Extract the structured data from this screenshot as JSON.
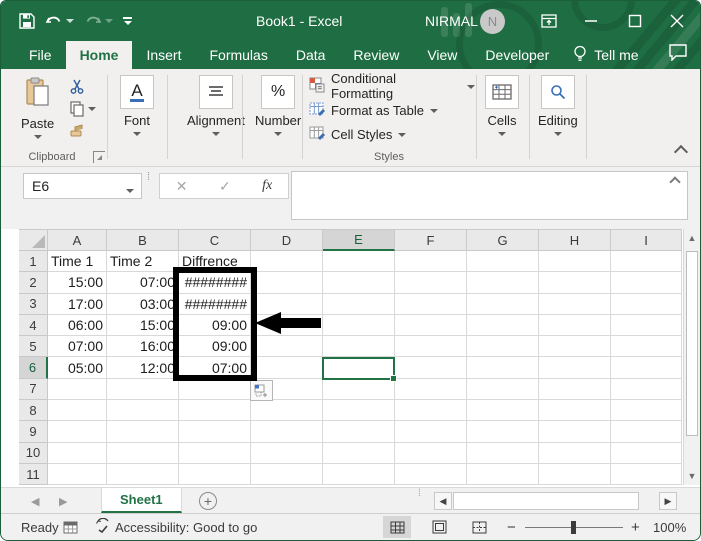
{
  "window": {
    "title": "Book1 - Excel",
    "user": "NIRMAL",
    "avatar_initial": "N"
  },
  "tabs": {
    "items": [
      {
        "label": "File"
      },
      {
        "label": "Home"
      },
      {
        "label": "Insert"
      },
      {
        "label": "Formulas"
      },
      {
        "label": "Data"
      },
      {
        "label": "Review"
      },
      {
        "label": "View"
      },
      {
        "label": "Developer"
      }
    ],
    "tell_me": "Tell me"
  },
  "ribbon": {
    "paste_label": "Paste",
    "clipboard_label": "Clipboard",
    "font_label": "Font",
    "alignment_label": "Alignment",
    "number_label": "Number",
    "number_icon_glyph": "%",
    "font_icon_glyph": "A",
    "styles_items": [
      {
        "label": "Conditional Formatting"
      },
      {
        "label": "Format as Table"
      },
      {
        "label": "Cell Styles"
      }
    ],
    "styles_label": "Styles",
    "cells_label": "Cells",
    "editing_label": "Editing"
  },
  "formula_bar": {
    "name_box": "E6",
    "cancel_glyph": "✕",
    "enter_glyph": "✓",
    "fx_label": "fx",
    "value": ""
  },
  "grid": {
    "columns": [
      "A",
      "B",
      "C",
      "D",
      "E",
      "F",
      "G",
      "H",
      "I"
    ],
    "rows": [
      "1",
      "2",
      "3",
      "4",
      "5",
      "6",
      "7",
      "8",
      "9",
      "10",
      "11"
    ],
    "cells": [
      [
        "Time 1",
        "Time 2",
        "Diffrence"
      ],
      [
        "15:00",
        "07:00",
        "########"
      ],
      [
        "17:00",
        "03:00",
        "########"
      ],
      [
        "06:00",
        "15:00",
        "09:00"
      ],
      [
        "07:00",
        "16:00",
        "09:00"
      ],
      [
        "05:00",
        "12:00",
        "07:00"
      ],
      [],
      [],
      [],
      [],
      []
    ],
    "selected_cell": "E6",
    "selected_column": "E",
    "selected_row": "6"
  },
  "sheet_tabs": {
    "active": "Sheet1",
    "add_label": "+"
  },
  "status_bar": {
    "ready": "Ready",
    "accessibility": "Accessibility: Good to go",
    "zoom_level": "100%",
    "zoom_minus": "−",
    "zoom_plus": "+"
  },
  "colors": {
    "accent": "#217346",
    "titlebar": "#1f6e43",
    "annotation": "#000000",
    "ribbon_bg": "#f1f0ef"
  }
}
